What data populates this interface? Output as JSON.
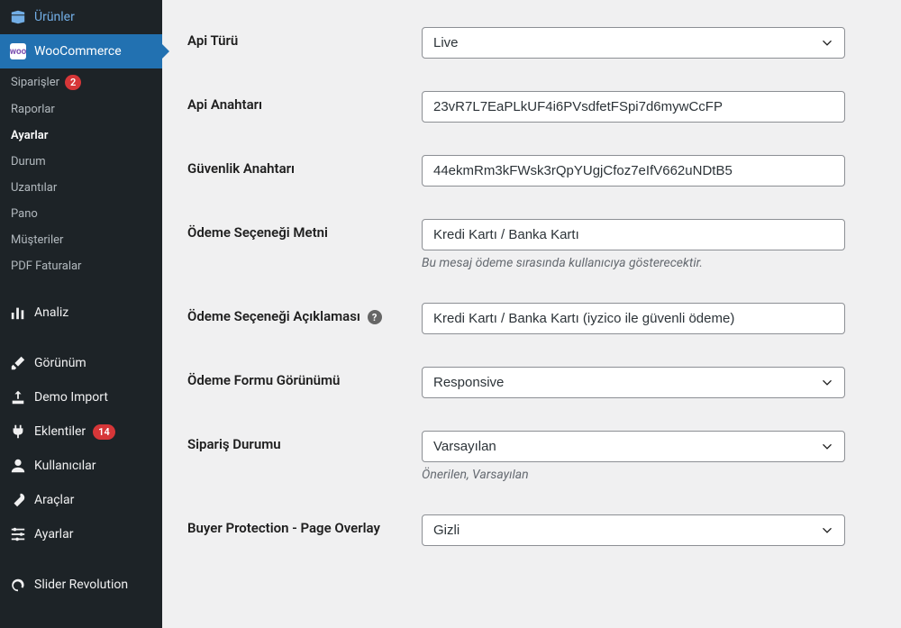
{
  "sidebar": {
    "urunler": "Ürünler",
    "woocommerce": "WooCommerce",
    "sub": {
      "siparisler": "Siparişler",
      "siparisler_badge": "2",
      "raporlar": "Raporlar",
      "ayarlar": "Ayarlar",
      "durum": "Durum",
      "uzantilar": "Uzantılar",
      "pano": "Pano",
      "musteriler": "Müşteriler",
      "pdf_faturalar": "PDF Faturalar"
    },
    "analiz": "Analiz",
    "gorunum": "Görünüm",
    "demo_import": "Demo Import",
    "eklentiler": "Eklentiler",
    "eklentiler_badge": "14",
    "kullanicilar": "Kullanıcılar",
    "araclar": "Araçlar",
    "ayarlar_main": "Ayarlar",
    "slider_revolution": "Slider Revolution"
  },
  "form": {
    "api_type": {
      "label": "Api Türü",
      "value": "Live"
    },
    "api_key": {
      "label": "Api Anahtarı",
      "value": "23vR7L7EaPLkUF4i6PVsdfetFSpi7d6mywCcFP"
    },
    "security_key": {
      "label": "Güvenlik Anahtarı",
      "value": "44ekmRm3kFWsk3rQpYUgjCfoz7eIfV662uNDtB5"
    },
    "payment_text": {
      "label": "Ödeme Seçeneği Metni",
      "value": "Kredi Kartı / Banka Kartı",
      "description": "Bu mesaj ödeme sırasında kullanıcıya gösterecektir."
    },
    "payment_desc": {
      "label": "Ödeme Seçeneği Açıklaması",
      "value": "Kredi Kartı / Banka Kartı (iyzico ile güvenli ödeme)"
    },
    "form_view": {
      "label": "Ödeme Formu Görünümü",
      "value": "Responsive"
    },
    "order_status": {
      "label": "Sipariş Durumu",
      "value": "Varsayılan",
      "description": "Önerilen, Varsayılan"
    },
    "buyer_protection": {
      "label": "Buyer Protection - Page Overlay",
      "value": "Gizli"
    }
  }
}
